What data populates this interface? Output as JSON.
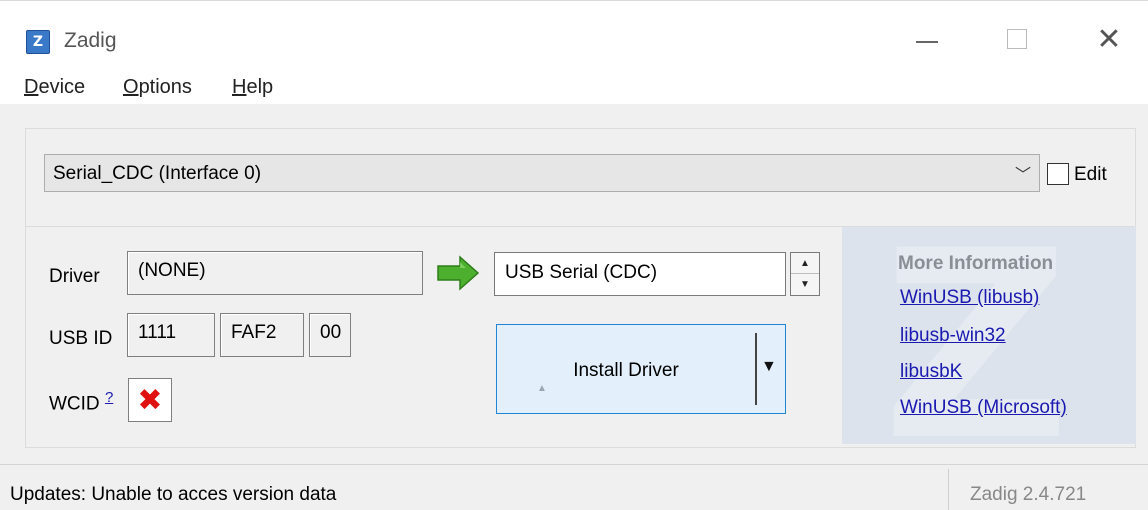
{
  "window": {
    "title": "Zadig",
    "icon_letter": "Z"
  },
  "menu": {
    "items": [
      {
        "accel": "D",
        "rest": "evice"
      },
      {
        "accel": "O",
        "rest": "ptions"
      },
      {
        "accel": "H",
        "rest": "elp"
      }
    ]
  },
  "device": {
    "selected": "Serial_CDC (Interface 0)",
    "edit_label": "Edit",
    "edit_checked": false
  },
  "driver": {
    "label": "Driver",
    "current": "(NONE)",
    "target": "USB Serial (CDC)"
  },
  "usbid": {
    "label": "USB ID",
    "vid": "1111",
    "pid": "FAF2",
    "mi": "00"
  },
  "wcid": {
    "label": "WCID",
    "help": "?",
    "status_icon": "red-x-icon",
    "status_glyph": "✖"
  },
  "install": {
    "label": "Install Driver"
  },
  "info": {
    "title": "More Information",
    "links": [
      "WinUSB (libusb)",
      "libusb-win32",
      "libusbK",
      "WinUSB (Microsoft)"
    ]
  },
  "status": {
    "message": "Updates: Unable to acces version data",
    "version": "Zadig 2.4.721"
  },
  "colors": {
    "accent": "#1f86d6",
    "link": "#1a1ab0",
    "error": "#e01010",
    "arrow": "#4caf2e"
  }
}
